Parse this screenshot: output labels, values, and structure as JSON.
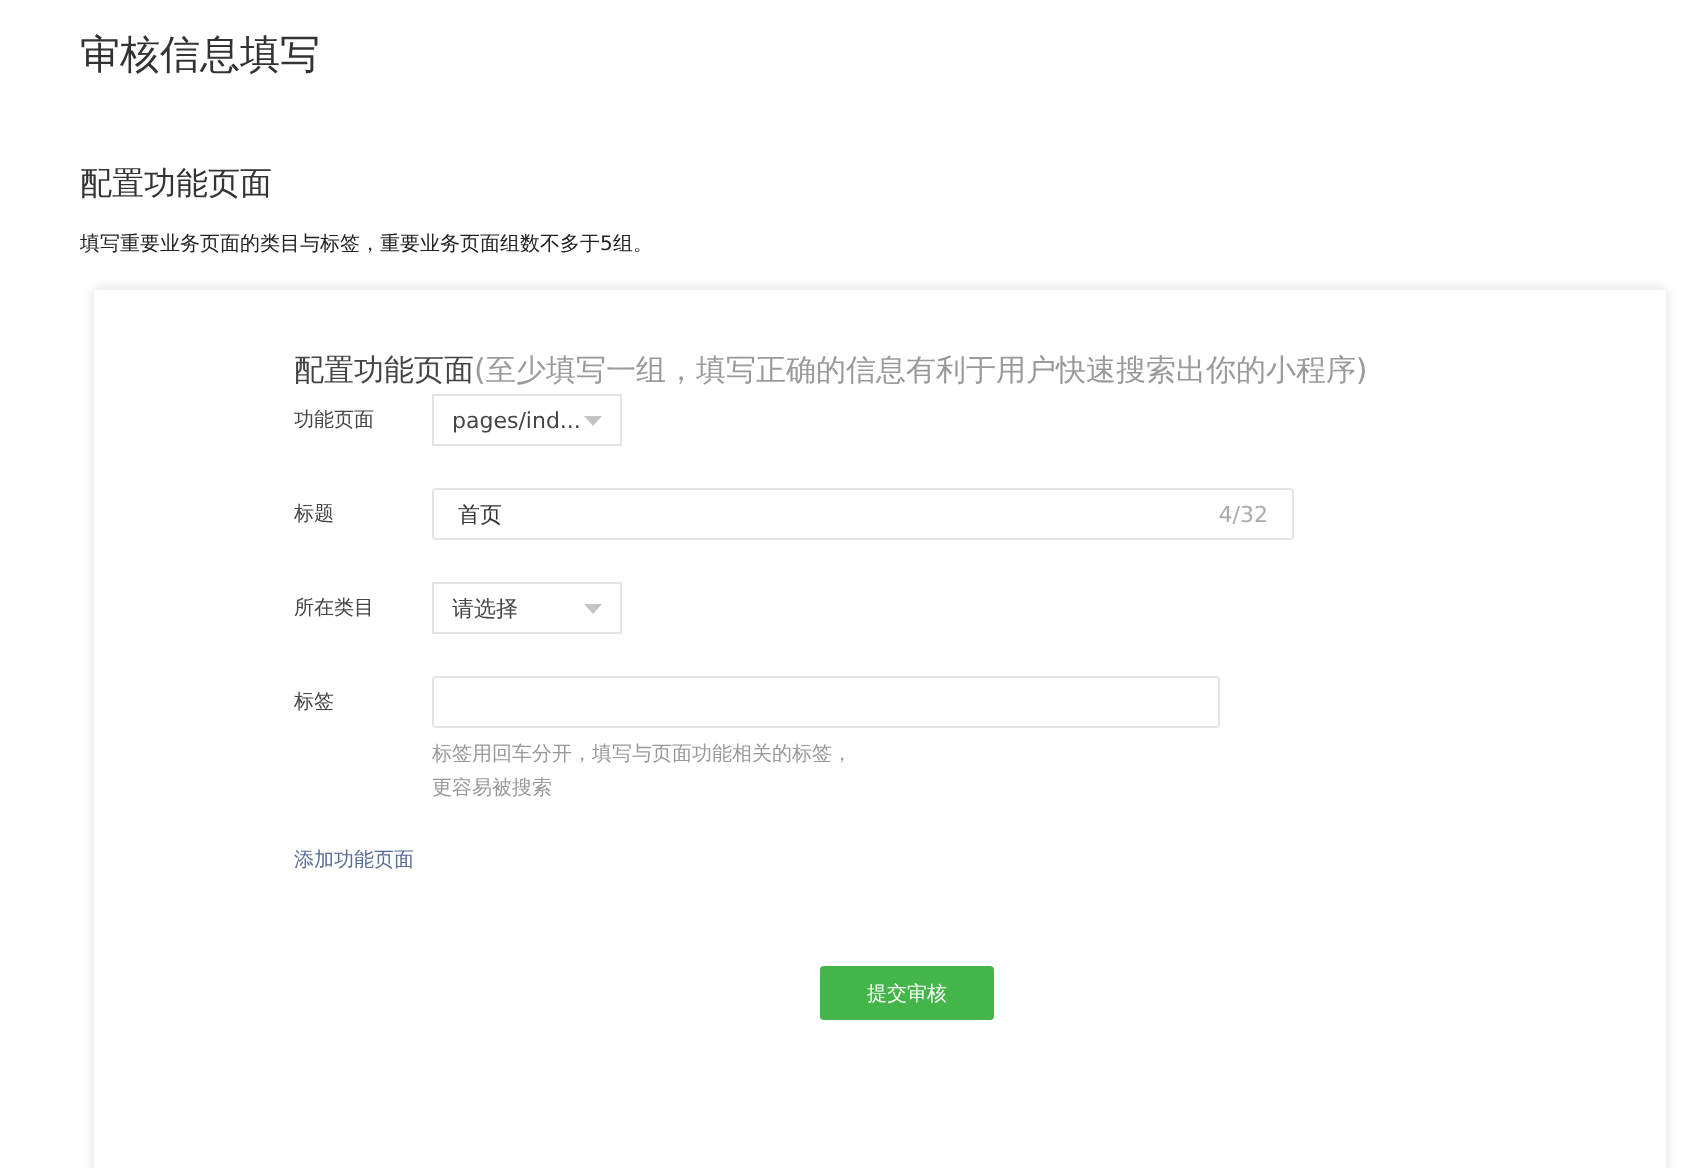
{
  "page_title": "审核信息填写",
  "section": {
    "title": "配置功能页面",
    "description": "填写重要业务页面的类目与标签，重要业务页面组数不多于5组。"
  },
  "card": {
    "title": "配置功能页面",
    "subtitle": "(至少填写一组，填写正确的信息有利于用户快速搜索出你的小程序)",
    "fields": [
      {
        "kind": "select",
        "label": "功能页面",
        "value": "pages/ind..."
      },
      {
        "kind": "text",
        "label": "标题",
        "value": "首页",
        "counter": "4/32"
      },
      {
        "kind": "select",
        "label": "所在类目",
        "value": "请选择"
      },
      {
        "kind": "tags",
        "label": "标签",
        "hint_lines": [
          "标签用回车分开，填写与页面功能相关的标签，",
          "更容易被搜索"
        ]
      }
    ],
    "add_link": "添加功能页面",
    "submit": "提交审核"
  }
}
